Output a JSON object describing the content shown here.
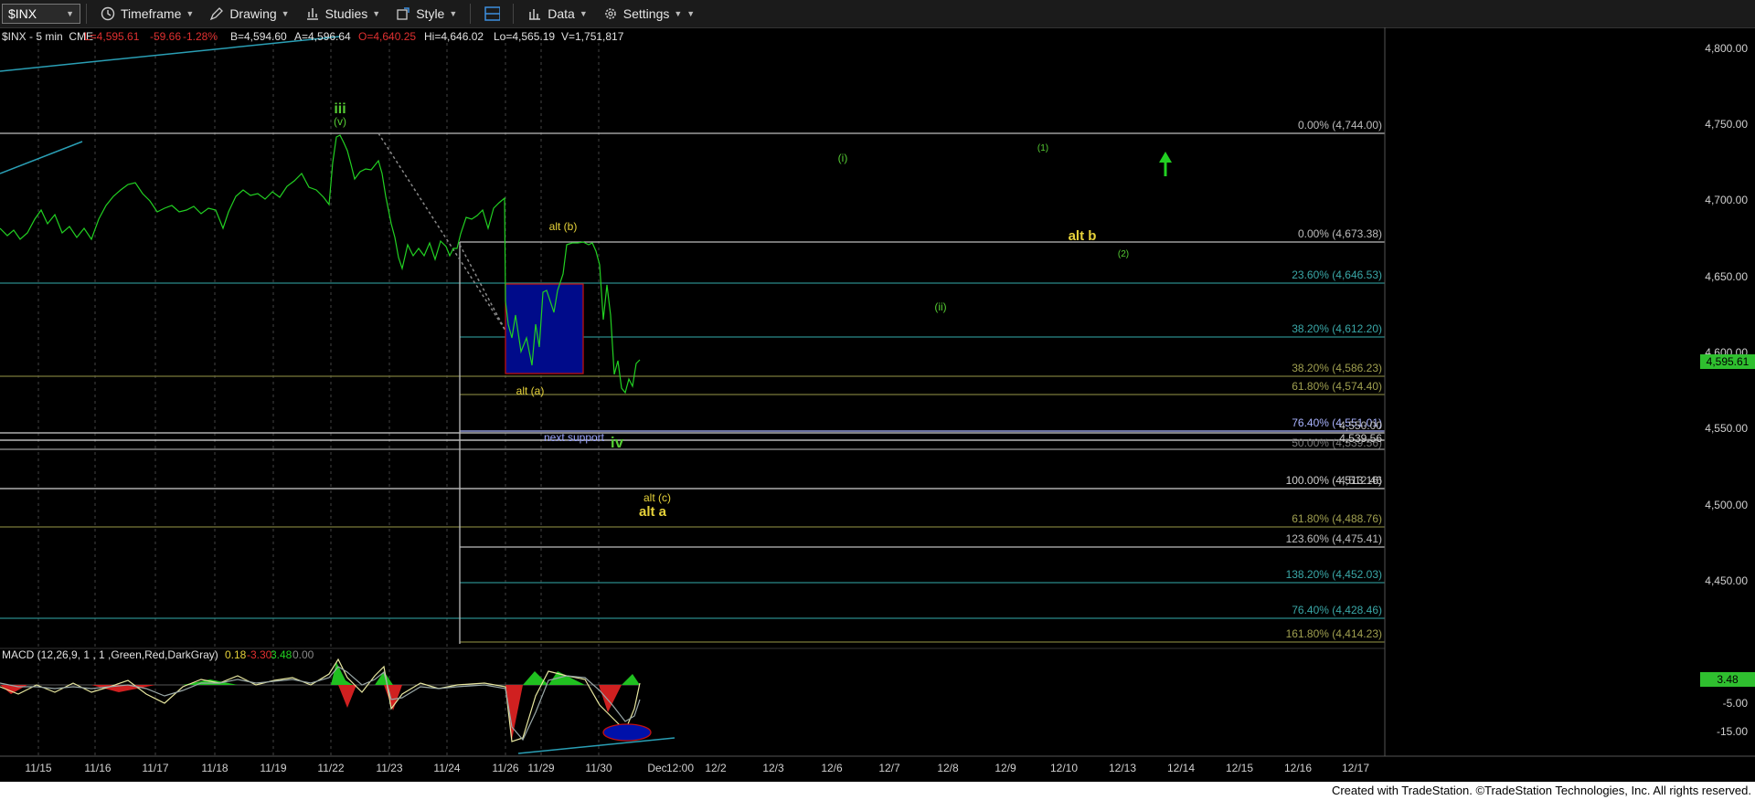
{
  "toolbar": {
    "symbol": "$INX",
    "timeframe": "Timeframe",
    "drawing": "Drawing",
    "studies": "Studies",
    "style": "Style",
    "data": "Data",
    "settings": "Settings"
  },
  "header": {
    "instrument": "$INX - 5 min  CME",
    "low": "L=4,595.61",
    "change": "-59.66",
    "pct": "-1.28%",
    "bid": "B=4,594.60",
    "ask": "A=4,596.64",
    "open": "O=4,640.25",
    "high": "Hi=4,646.02",
    "lo": "Lo=4,565.19",
    "volume": "V=1,751,817"
  },
  "macd_header": {
    "label": "MACD (12,26,9, 1 , 1 ,Green,Red,DarkGray)",
    "v1": "0.18",
    "v2": "-3.30",
    "v3": "3.48",
    "v4": "0.00"
  },
  "price_axis": [
    "4,800.00",
    "4,750.00",
    "4,700.00",
    "4,650.00",
    "4,600.00",
    "4,550.00",
    "4,500.00",
    "4,450.00"
  ],
  "macd_axis": [
    "-5.00",
    "-15.00"
  ],
  "macd_current": "3.48",
  "current_price": "4,595.61",
  "date_axis": [
    "11/15",
    "11/16",
    "11/17",
    "11/18",
    "11/19",
    "11/22",
    "11/23",
    "11/24",
    "11/26",
    "11/29",
    "11/30",
    "Dec",
    "12:00",
    "12/2",
    "12/3",
    "12/6",
    "12/7",
    "12/8",
    "12/9",
    "12/10",
    "12/13",
    "12/14",
    "12/15",
    "12/16",
    "12/17"
  ],
  "fib_labels": [
    "0.00% (4,744.00)",
    "0.00% (4,673.38)",
    "23.60% (4,646.53)",
    "38.20% (4,612.20)",
    "38.20% (4,586.23)",
    "61.80% (4,574.40)",
    "76.40% (4,551.01)",
    "50.00% (4,539.56)",
    "100.00% (4,513.16)",
    "61.80% (4,488.76)",
    "123.60% (4,475.41)",
    "138.20% (4,452.03)",
    "76.40% (4,428.46)",
    "161.80% (4,414.23)"
  ],
  "overlap_labels": [
    "4,550.00",
    "4,539.56",
    "4,512.46"
  ],
  "annotations": {
    "iii": "iii",
    "v": "(v)",
    "alt_b_paren": "alt (b)",
    "alt_a_paren": "alt (a)",
    "next_support": "next support",
    "iv": "iv",
    "alt_c": "alt (c)",
    "alt_a": "alt a",
    "i": "(i)",
    "one": "(1)",
    "alt_b": "alt b",
    "two": "(2)",
    "ii": "(ii)"
  },
  "footer": "Created with TradeStation. ©TradeStation Technologies, Inc. All rights reserved.",
  "colors": {
    "up": "#22cc22",
    "annotation_yellow": "#e6d23a",
    "annotation_green": "#55cc33",
    "blue_box": "#000b8a",
    "cyan_line": "#30a0b0"
  }
}
